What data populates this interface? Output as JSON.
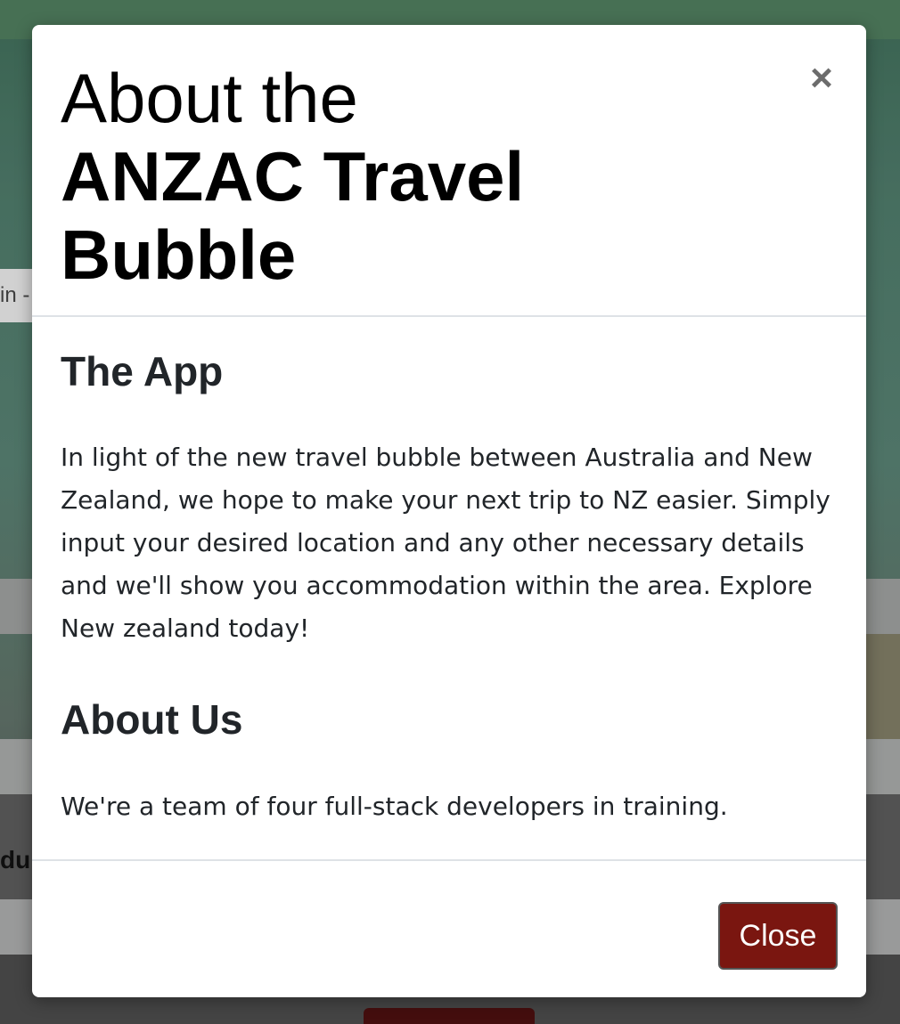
{
  "background": {
    "fragment_input_text": "in -",
    "fragment_label_text": "dul"
  },
  "modal": {
    "title_line1": "About the",
    "title_line2": "ANZAC Travel",
    "title_line3": "Bubble",
    "close_icon_glyph": "×",
    "sections": [
      {
        "heading": "The App",
        "text": "In light of the new travel bubble between Australia and New Zealand, we hope to make your next trip to NZ easier. Simply input your desired location and any other necessary details and we'll show you accommodation within the area. Explore New zealand today!"
      },
      {
        "heading": "About Us",
        "text": "We're a team of four full-stack developers in training."
      }
    ],
    "footer": {
      "close_label": "Close"
    }
  },
  "colors": {
    "close_button_bg": "#7a1610",
    "text": "#212529",
    "divider": "#dee2e6"
  },
  "icons": {
    "close": "close-icon"
  }
}
